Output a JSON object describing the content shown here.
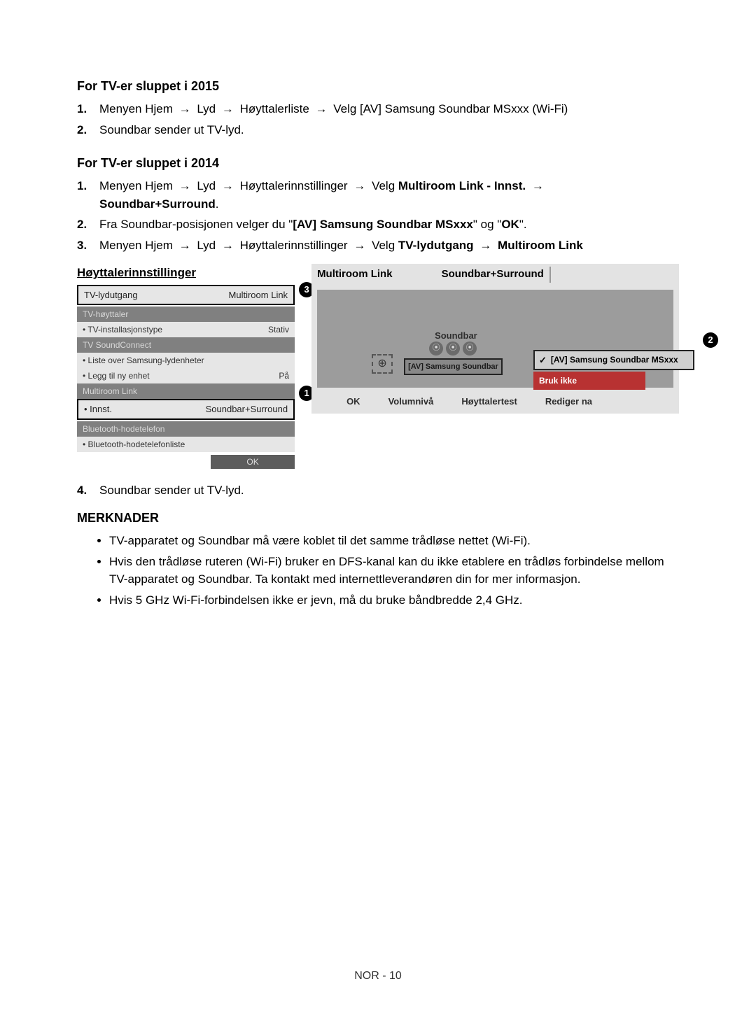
{
  "sections": {
    "s2015": {
      "title": "For TV-er sluppet i 2015",
      "steps": [
        {
          "n": "1.",
          "text_pre": "Menyen Hjem",
          "path": [
            "Lyd",
            "Høyttalerliste",
            "Velg [AV] Samsung Soundbar MSxxx (Wi-Fi)"
          ]
        },
        {
          "n": "2.",
          "plain": "Soundbar sender ut TV-lyd."
        }
      ]
    },
    "s2014": {
      "title": "For TV-er sluppet i 2014",
      "step1": {
        "n": "1.",
        "pre": "Menyen Hjem",
        "mid": [
          "Lyd",
          "Høyttalerinnstillinger",
          "Velg"
        ],
        "bold1": "Multiroom Link - Innst.",
        "bold2": "Soundbar+Surround",
        "tail": "."
      },
      "step2": {
        "n": "2.",
        "pre": "Fra Soundbar-posisjonen velger du \"",
        "bold1": "[AV] Samsung Soundbar MSxxx",
        "mid": "\" og \"",
        "bold2": "OK",
        "post": "\"."
      },
      "step3": {
        "n": "3.",
        "pre": "Menyen Hjem",
        "mid": [
          "Lyd",
          "Høyttalerinnstillinger",
          "Velg"
        ],
        "bold1": "TV-lydutgang",
        "bold2": "Multiroom Link"
      },
      "step4": {
        "n": "4.",
        "plain": "Soundbar sender ut TV-lyd."
      }
    },
    "merknader": {
      "title": "MERKNADER",
      "items": [
        "TV-apparatet og Soundbar må være koblet til det samme trådløse nettet (Wi-Fi).",
        "Hvis den trådløse ruteren (Wi-Fi) bruker en DFS-kanal kan du ikke etablere en trådløs forbindelse mellom TV-apparatet og Soundbar. Ta kontakt med internettleverandøren din for mer informasjon.",
        "Hvis 5 GHz Wi-Fi-forbindelsen ikke er jevn, må du bruke båndbredde 2,4 GHz."
      ]
    }
  },
  "arrow": "→",
  "diagram_left": {
    "title": "Høyttalerinnstillinger",
    "row_sel": {
      "label": "TV-lydutgang",
      "value": "Multiroom Link"
    },
    "rows": [
      {
        "type": "muted",
        "label": "TV-høyttaler"
      },
      {
        "type": "item",
        "label": "• TV-installasjonstype",
        "value": "Stativ"
      },
      {
        "type": "muted",
        "label": "TV SoundConnect"
      },
      {
        "type": "item",
        "label": "• Liste over Samsung-lydenheter",
        "value": ""
      },
      {
        "type": "item",
        "label": "• Legg til ny enhet",
        "value": "På"
      },
      {
        "type": "muted",
        "label": "Multiroom Link"
      }
    ],
    "row_innst": {
      "label": "• Innst.",
      "value": "Soundbar+Surround"
    },
    "rows2": [
      {
        "type": "muted",
        "label": "Bluetooth-hodetelefon"
      },
      {
        "type": "item",
        "label": "• Bluetooth-hodetelefonliste",
        "value": ""
      }
    ],
    "ok": "OK",
    "badges": {
      "b1": "1",
      "b3": "3"
    }
  },
  "diagram_right": {
    "tabs": {
      "t1": "Multiroom Link",
      "t2": "Soundbar+Surround"
    },
    "soundbar_label": "Soundbar",
    "av_chip": "[AV] Samsung Soundbar",
    "plus": "⊕",
    "dot_glyphs": [
      "⦿",
      "⦿",
      "⦿"
    ],
    "popup": {
      "opt1": "[AV] Samsung Soundbar MSxxx",
      "opt2": "Bruk ikke"
    },
    "footer": {
      "ok": "OK",
      "vol": "Volumnivå",
      "test": "Høyttalertest",
      "edit": "Rediger na"
    },
    "badge": "2"
  },
  "page_footer": "NOR - 10"
}
